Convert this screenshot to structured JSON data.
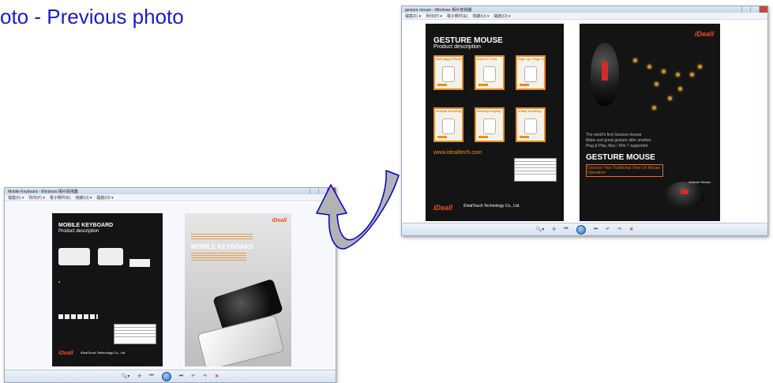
{
  "slide": {
    "title": "oto - Previous photo"
  },
  "mouse_window": {
    "title": "gesture mouse - Windows 相片檢視器",
    "menu": [
      "檔案(F) ▾",
      "列印(P) ▾",
      "電子郵件(E)",
      "燒錄(U) ▾",
      "開啟(O) ▾"
    ],
    "page_left": {
      "heading": "GESTURE MOUSE",
      "subheading": "Product description",
      "features": [
        "Web page/ Photo page Turning",
        "Zoom In / out",
        "Page up / Page Down",
        "Vertical Scrolling",
        "Desktop display",
        "4-Way scrolling"
      ],
      "url": "www.idealltech.com",
      "company": "iDealTouch Technology Co., Ltd.",
      "brand": "iDeall"
    },
    "page_right": {
      "brand": "iDeall",
      "tagline_1": "The world's first Gesture mouse",
      "tagline_2": "Make and great gesture after another.",
      "tagline_3": "Plug & Play, Mac / Win 7 supported",
      "product_name": "GESTURE MOUSE",
      "headline": "Discover Your Traditional View On Mouse Operation!",
      "caption": "Gesture Sensor"
    },
    "controls": [
      "🔍▾",
      "✢",
      "⏮",
      "⏭",
      "↶",
      "↷",
      "✕"
    ]
  },
  "keyboard_window": {
    "title": "Mobile Keyboard - Windows 相片檢視器",
    "menu": [
      "檔案(F) ▾",
      "列印(P) ▾",
      "電子郵件(E)",
      "燒錄(U) ▾",
      "開啟(O) ▾"
    ],
    "page_left": {
      "heading": "MOBILE KEYBOARD",
      "subheading": "Product description",
      "brand": "iDeall",
      "company": "iDealTouch Technology Co., Ltd."
    },
    "page_right": {
      "brand": "iDeall",
      "product_name": "MOBILE KEYBOARD"
    },
    "controls": [
      "🔍▾",
      "✢",
      "⏮",
      "⏭",
      "↶",
      "↷",
      "✕"
    ]
  },
  "colors": {
    "title": "#1a1acc",
    "accent_orange": "#e8901f",
    "arrow_fill": "#b3b3b3",
    "arrow_stroke": "#0000cc"
  }
}
